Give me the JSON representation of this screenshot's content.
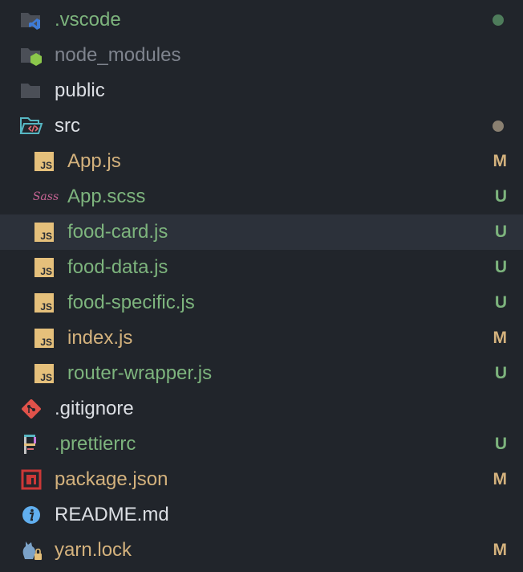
{
  "colors": {
    "modified": "#d4b27d",
    "untracked": "#7db47d",
    "plain": "#dcdfe4",
    "ignored": "#7f848e",
    "dot_green": "#4e7c5b",
    "dot_gray": "#8a8071",
    "folder": "#4b4f57",
    "js": "#e5c07b"
  },
  "tree": [
    {
      "name": ".vscode",
      "icon": "vscode-folder-icon",
      "status": "dot-green",
      "color": "untracked"
    },
    {
      "name": "node_modules",
      "icon": "node-folder-icon",
      "status": "",
      "color": "ignored"
    },
    {
      "name": "public",
      "icon": "folder-icon",
      "status": "",
      "color": "plain"
    },
    {
      "name": "src",
      "icon": "src-folder-open-icon",
      "status": "dot-gray",
      "color": "plain"
    },
    {
      "name": "App.js",
      "icon": "js-icon",
      "status": "M",
      "color": "modified"
    },
    {
      "name": "App.scss",
      "icon": "sass-icon",
      "status": "U",
      "color": "untracked"
    },
    {
      "name": "food-card.js",
      "icon": "js-icon",
      "status": "U",
      "color": "untracked"
    },
    {
      "name": "food-data.js",
      "icon": "js-icon",
      "status": "U",
      "color": "untracked"
    },
    {
      "name": "food-specific.js",
      "icon": "js-icon",
      "status": "U",
      "color": "untracked"
    },
    {
      "name": "index.js",
      "icon": "js-icon",
      "status": "M",
      "color": "modified"
    },
    {
      "name": "router-wrapper.js",
      "icon": "js-icon",
      "status": "U",
      "color": "untracked"
    },
    {
      "name": ".gitignore",
      "icon": "git-icon",
      "status": "",
      "color": "plain"
    },
    {
      "name": ".prettierrc",
      "icon": "prettier-icon",
      "status": "U",
      "color": "untracked"
    },
    {
      "name": "package.json",
      "icon": "npm-icon",
      "status": "M",
      "color": "modified"
    },
    {
      "name": "README.md",
      "icon": "info-icon",
      "status": "",
      "color": "plain"
    },
    {
      "name": "yarn.lock",
      "icon": "yarn-lock-icon",
      "status": "M",
      "color": "modified"
    }
  ],
  "selected_index": 6,
  "js_glyph": "JS",
  "sass_glyph": "Sass"
}
